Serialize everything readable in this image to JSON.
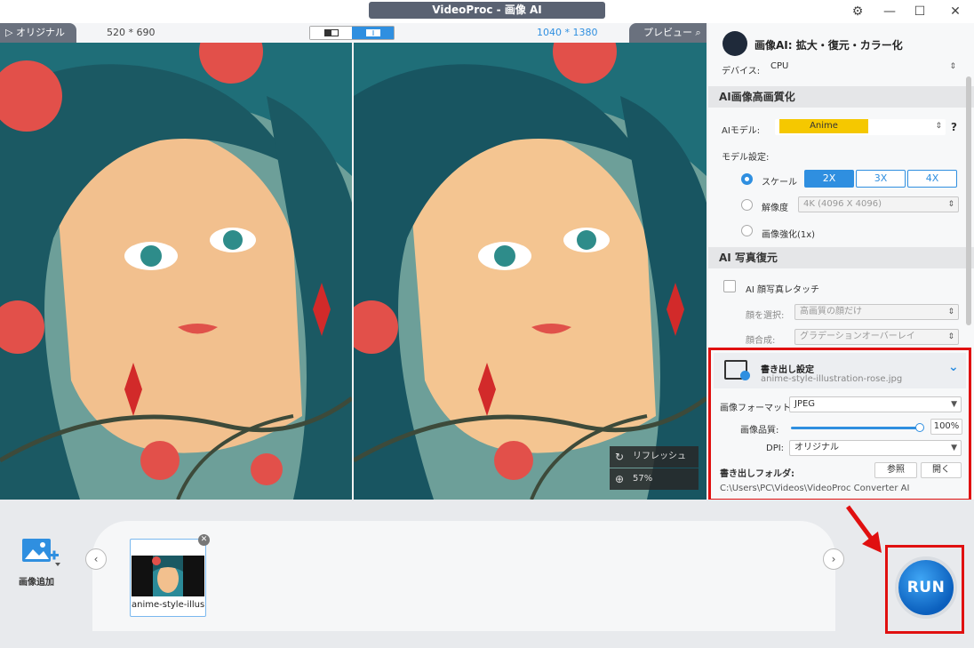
{
  "window": {
    "title": "VideoProc - 画像 AI"
  },
  "viewer": {
    "original_tab": "オリジナル",
    "original_res": "520 * 690",
    "preview_res": "1040 * 1380",
    "preview_tab": "プレビュー",
    "refresh_label": "リフレッシュ",
    "zoom_label": "57%"
  },
  "panel": {
    "title": "画像AI: 拡大・復元・カラー化",
    "device_label": "デバイス:",
    "device_value": "CPU",
    "enhance_section": "AI画像高画質化",
    "model_label": "AIモデル:",
    "model_value": "Anime",
    "help": "?",
    "model_settings_label": "モデル設定:",
    "scale_label": "スケール",
    "scale_options": [
      "2X",
      "3X",
      "4X"
    ],
    "resolution_label": "解像度",
    "resolution_value": "4K (4096 X 4096)",
    "enhance_label": "画像強化(1x)",
    "restore_section": "AI 写真復元",
    "face_retouch_label": "AI 顔写真レタッチ",
    "face_select_label": "顔を選択:",
    "face_select_value": "高画質の顔だけ",
    "face_blend_label": "顔合成:",
    "face_blend_value": "グラデーションオーバーレイ"
  },
  "export": {
    "title": "書き出し設定",
    "filename": "anime-style-illustration-rose.jpg",
    "format_label": "画像フォーマット:",
    "format_value": "JPEG",
    "quality_label": "画像品質:",
    "quality_value": "100%",
    "dpi_label": "DPI:",
    "dpi_value": "オリジナル",
    "folder_label": "書き出しフォルダ:",
    "browse_label": "参照",
    "open_label": "開く",
    "folder_path": "C:\\Users\\PC\\Videos\\VideoProc Converter AI"
  },
  "bottom": {
    "add_label": "画像追加",
    "thumb_name": "anime-style-illust",
    "run_label": "RUN"
  },
  "colors": {
    "accent": "#2f8fe0",
    "highlight": "#e01010",
    "model_badge": "#f5c800"
  }
}
